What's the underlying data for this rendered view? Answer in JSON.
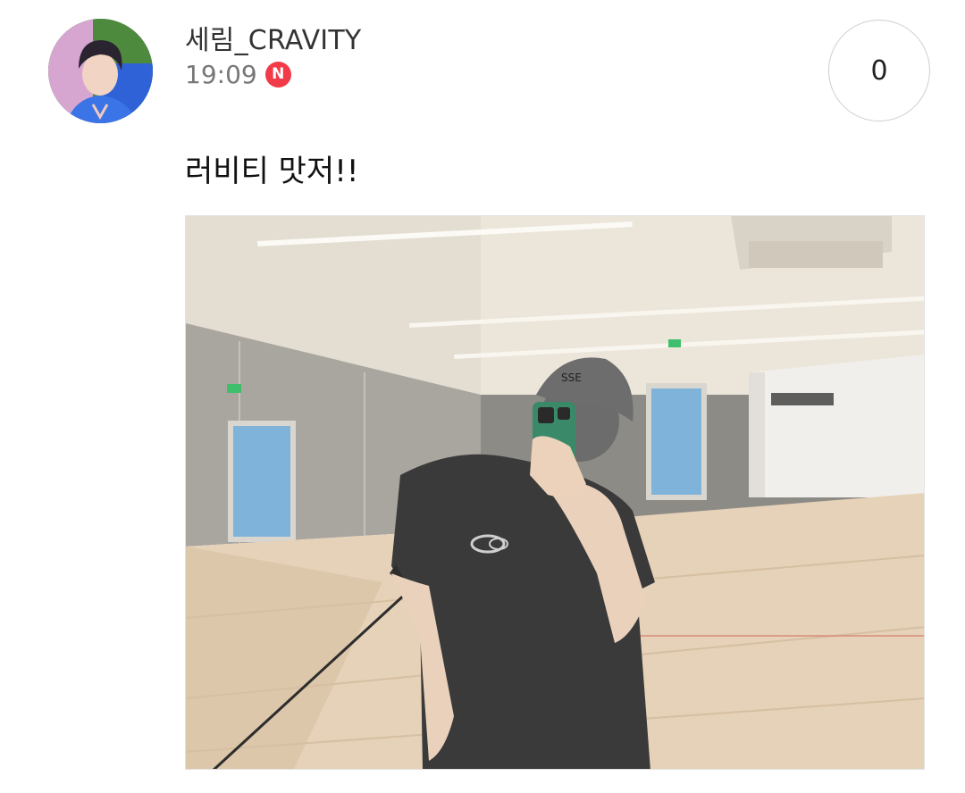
{
  "post": {
    "author": "세림_CRAVITY",
    "time": "19:09",
    "new_badge": "N",
    "count": "0",
    "text": "러비티 맛저!!"
  },
  "icons": {
    "avatar": "profile-avatar",
    "new_badge": "new-badge-icon"
  },
  "colors": {
    "new_badge": "#f23a48",
    "author_text": "#333333",
    "time_text": "#777777",
    "count_border": "#cfcfcf"
  }
}
